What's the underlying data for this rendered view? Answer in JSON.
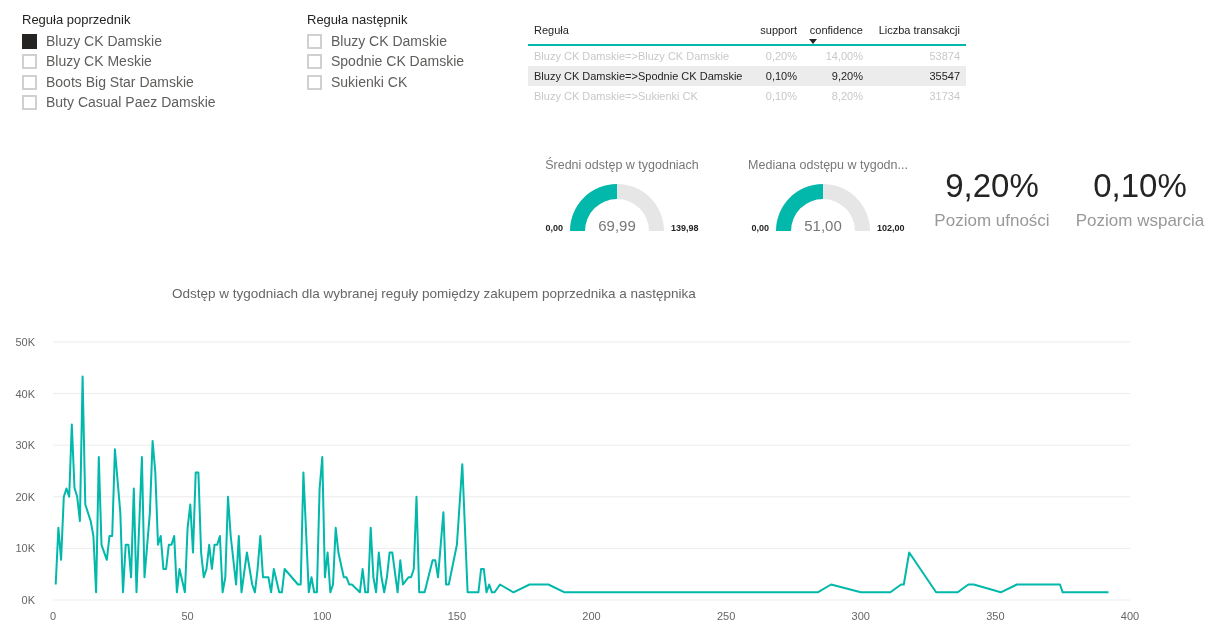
{
  "slicers": [
    {
      "title": "Reguła poprzednik",
      "items": [
        {
          "label": "Bluzy CK Damskie",
          "checked": true
        },
        {
          "label": "Bluzy CK Meskie",
          "checked": false
        },
        {
          "label": "Boots Big Star Damskie",
          "checked": false
        },
        {
          "label": "Buty Casual Paez Damskie",
          "checked": false
        }
      ]
    },
    {
      "title": "Reguła następnik",
      "items": [
        {
          "label": "Bluzy CK Damskie",
          "checked": false
        },
        {
          "label": "Spodnie CK Damskie",
          "checked": false
        },
        {
          "label": "Sukienki CK",
          "checked": false
        }
      ]
    }
  ],
  "table": {
    "columns": [
      {
        "label": "Reguła",
        "sorted": false
      },
      {
        "label": "support",
        "sorted": false
      },
      {
        "label": "confidence",
        "sorted": true
      },
      {
        "label": "Liczba transakcji",
        "sorted": false
      }
    ],
    "rows": [
      {
        "selected": false,
        "cells": [
          "Bluzy CK Damskie=>Bluzy CK Damskie",
          "0,20%",
          "14,00%",
          "53874"
        ]
      },
      {
        "selected": true,
        "cells": [
          "Bluzy CK Damskie=>Spodnie CK Damskie",
          "0,10%",
          "9,20%",
          "35547"
        ]
      },
      {
        "selected": false,
        "cells": [
          "Bluzy CK Damskie=>Sukienki CK",
          "0,10%",
          "8,20%",
          "31734"
        ]
      }
    ]
  },
  "gauges": [
    {
      "title": "Średni odstęp w tygodniach",
      "value": "69,99",
      "min": "0,00",
      "max": "139,98",
      "level": 0.5
    },
    {
      "title": "Mediana odstępu w tygodn...",
      "value": "51,00",
      "min": "0,00",
      "max": "102,00",
      "level": 0.5
    }
  ],
  "kpis": [
    {
      "value": "9,20%",
      "label": "Poziom ufności"
    },
    {
      "value": "0,10%",
      "label": "Poziom wsparcia"
    }
  ],
  "chart": {
    "title": "Odstęp w tygodniach dla wybranej reguły pomiędzy zakupem poprzednika a następnika",
    "chart_data": {
      "type": "line",
      "grid": true,
      "xlim": [
        0,
        400
      ],
      "ylim": [
        0,
        50000
      ],
      "xticks": [
        0,
        50,
        100,
        150,
        200,
        250,
        300,
        350,
        400
      ],
      "yticks": [
        {
          "value": 0,
          "label": "0K"
        },
        {
          "value": 10000,
          "label": "10K"
        },
        {
          "value": 20000,
          "label": "20K"
        },
        {
          "value": 30000,
          "label": "30K"
        },
        {
          "value": 40000,
          "label": "40K"
        },
        {
          "value": 50000,
          "label": "50K"
        }
      ],
      "x": [
        1,
        2,
        3,
        4,
        5,
        6,
        7,
        8,
        9,
        10,
        11,
        12,
        14,
        15,
        16,
        17,
        18,
        20,
        21,
        22,
        23,
        25,
        26,
        27,
        28,
        29,
        30,
        31,
        33,
        34,
        36,
        37,
        38,
        39,
        40,
        41,
        42,
        43,
        44,
        45,
        46,
        47,
        49,
        50,
        51,
        52,
        53,
        54,
        55,
        56,
        57,
        58,
        59,
        60,
        61,
        62,
        63,
        64,
        65,
        66,
        68,
        69,
        70,
        72,
        74,
        75,
        76,
        77,
        78,
        80,
        81,
        82,
        84,
        85,
        86,
        91,
        92,
        93,
        95,
        96,
        97,
        98,
        99,
        100,
        101,
        102,
        103,
        104,
        105,
        106,
        108,
        109,
        110,
        111,
        114,
        115,
        116,
        117,
        118,
        119,
        120,
        121,
        122,
        123,
        124,
        125,
        126,
        128,
        129,
        130,
        132,
        133,
        134,
        135,
        136,
        138,
        141,
        142,
        143,
        145,
        146,
        147,
        150,
        152,
        154,
        158,
        159,
        160,
        161,
        162,
        163,
        164,
        166,
        171,
        177,
        184,
        190,
        284,
        289,
        300,
        311,
        315,
        316,
        318,
        328,
        336,
        340,
        342,
        352,
        358,
        374,
        375,
        392
      ],
      "series": [
        {
          "color": "#01b8aa",
          "values": [
            3000,
            14000,
            7800,
            20000,
            21600,
            20000,
            34000,
            21700,
            20000,
            15300,
            43300,
            18500,
            15300,
            12400,
            1500,
            27700,
            10700,
            7800,
            12400,
            12400,
            29200,
            17000,
            1500,
            10700,
            10700,
            4400,
            21600,
            1500,
            27700,
            4400,
            17000,
            30800,
            24800,
            10700,
            12400,
            6000,
            6000,
            10700,
            10700,
            12400,
            1500,
            6000,
            1500,
            14000,
            18500,
            9200,
            24700,
            24700,
            9200,
            4400,
            6000,
            10700,
            6000,
            10700,
            10700,
            12400,
            1500,
            4400,
            20000,
            12400,
            3000,
            12400,
            1500,
            9200,
            3000,
            1500,
            6000,
            12400,
            4400,
            4400,
            1500,
            6000,
            1500,
            1500,
            6000,
            3000,
            3000,
            24700,
            1500,
            4400,
            1500,
            1500,
            21600,
            27700,
            4400,
            9200,
            1500,
            3000,
            14000,
            9200,
            4400,
            4400,
            3000,
            3000,
            1500,
            6000,
            1500,
            1500,
            14000,
            4400,
            1500,
            9200,
            4400,
            1500,
            4400,
            9200,
            9200,
            1500,
            7700,
            3000,
            4400,
            4400,
            6000,
            20000,
            1500,
            1500,
            7700,
            7700,
            4400,
            17000,
            3000,
            3000,
            10700,
            26300,
            1500,
            1500,
            6000,
            6000,
            1500,
            3000,
            1500,
            1500,
            3000,
            1500,
            3000,
            3000,
            1500,
            1500,
            3000,
            1500,
            1500,
            3000,
            3000,
            9200,
            1500,
            1500,
            3000,
            3000,
            1500,
            3000,
            3000,
            1500,
            1500
          ]
        }
      ]
    }
  }
}
